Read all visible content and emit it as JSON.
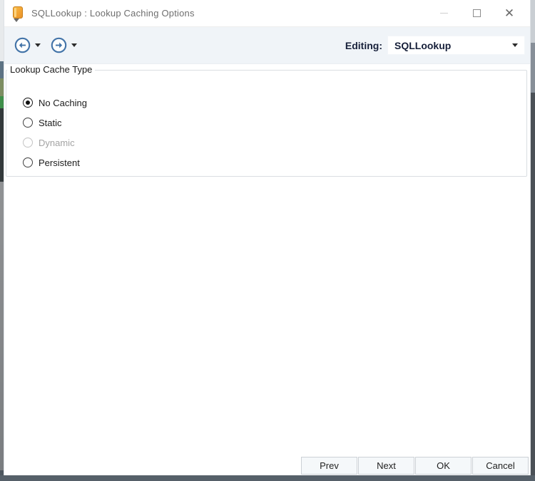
{
  "window": {
    "title": "SQLLookup : Lookup Caching Options",
    "controls": {
      "minimize_icon": "minimize-dash",
      "maximize_icon": "maximize-square",
      "close_icon": "close-x",
      "close_glyph": "✕"
    }
  },
  "toolbar": {
    "back_icon": "circle-arrow-left",
    "forward_icon": "circle-arrow-right",
    "editing_label": "Editing:",
    "editing_value": "SQLLookup"
  },
  "groupbox": {
    "label": "Lookup Cache Type",
    "options": [
      {
        "label": "No Caching",
        "selected": true,
        "enabled": true
      },
      {
        "label": "Static",
        "selected": false,
        "enabled": true
      },
      {
        "label": "Dynamic",
        "selected": false,
        "enabled": false
      },
      {
        "label": "Persistent",
        "selected": false,
        "enabled": true
      }
    ]
  },
  "footer": {
    "buttons": [
      "Prev",
      "Next",
      "OK",
      "Cancel"
    ]
  },
  "colors": {
    "accent_blue": "#4273a8",
    "toolbar_bg": "#f0f4f8",
    "title_text": "#6e6e6e",
    "disabled_text": "#a3a3a3",
    "groupbox_border": "#dadee2",
    "desktop_strip_dark": "#566069",
    "icon_orange": "#f2a433"
  }
}
